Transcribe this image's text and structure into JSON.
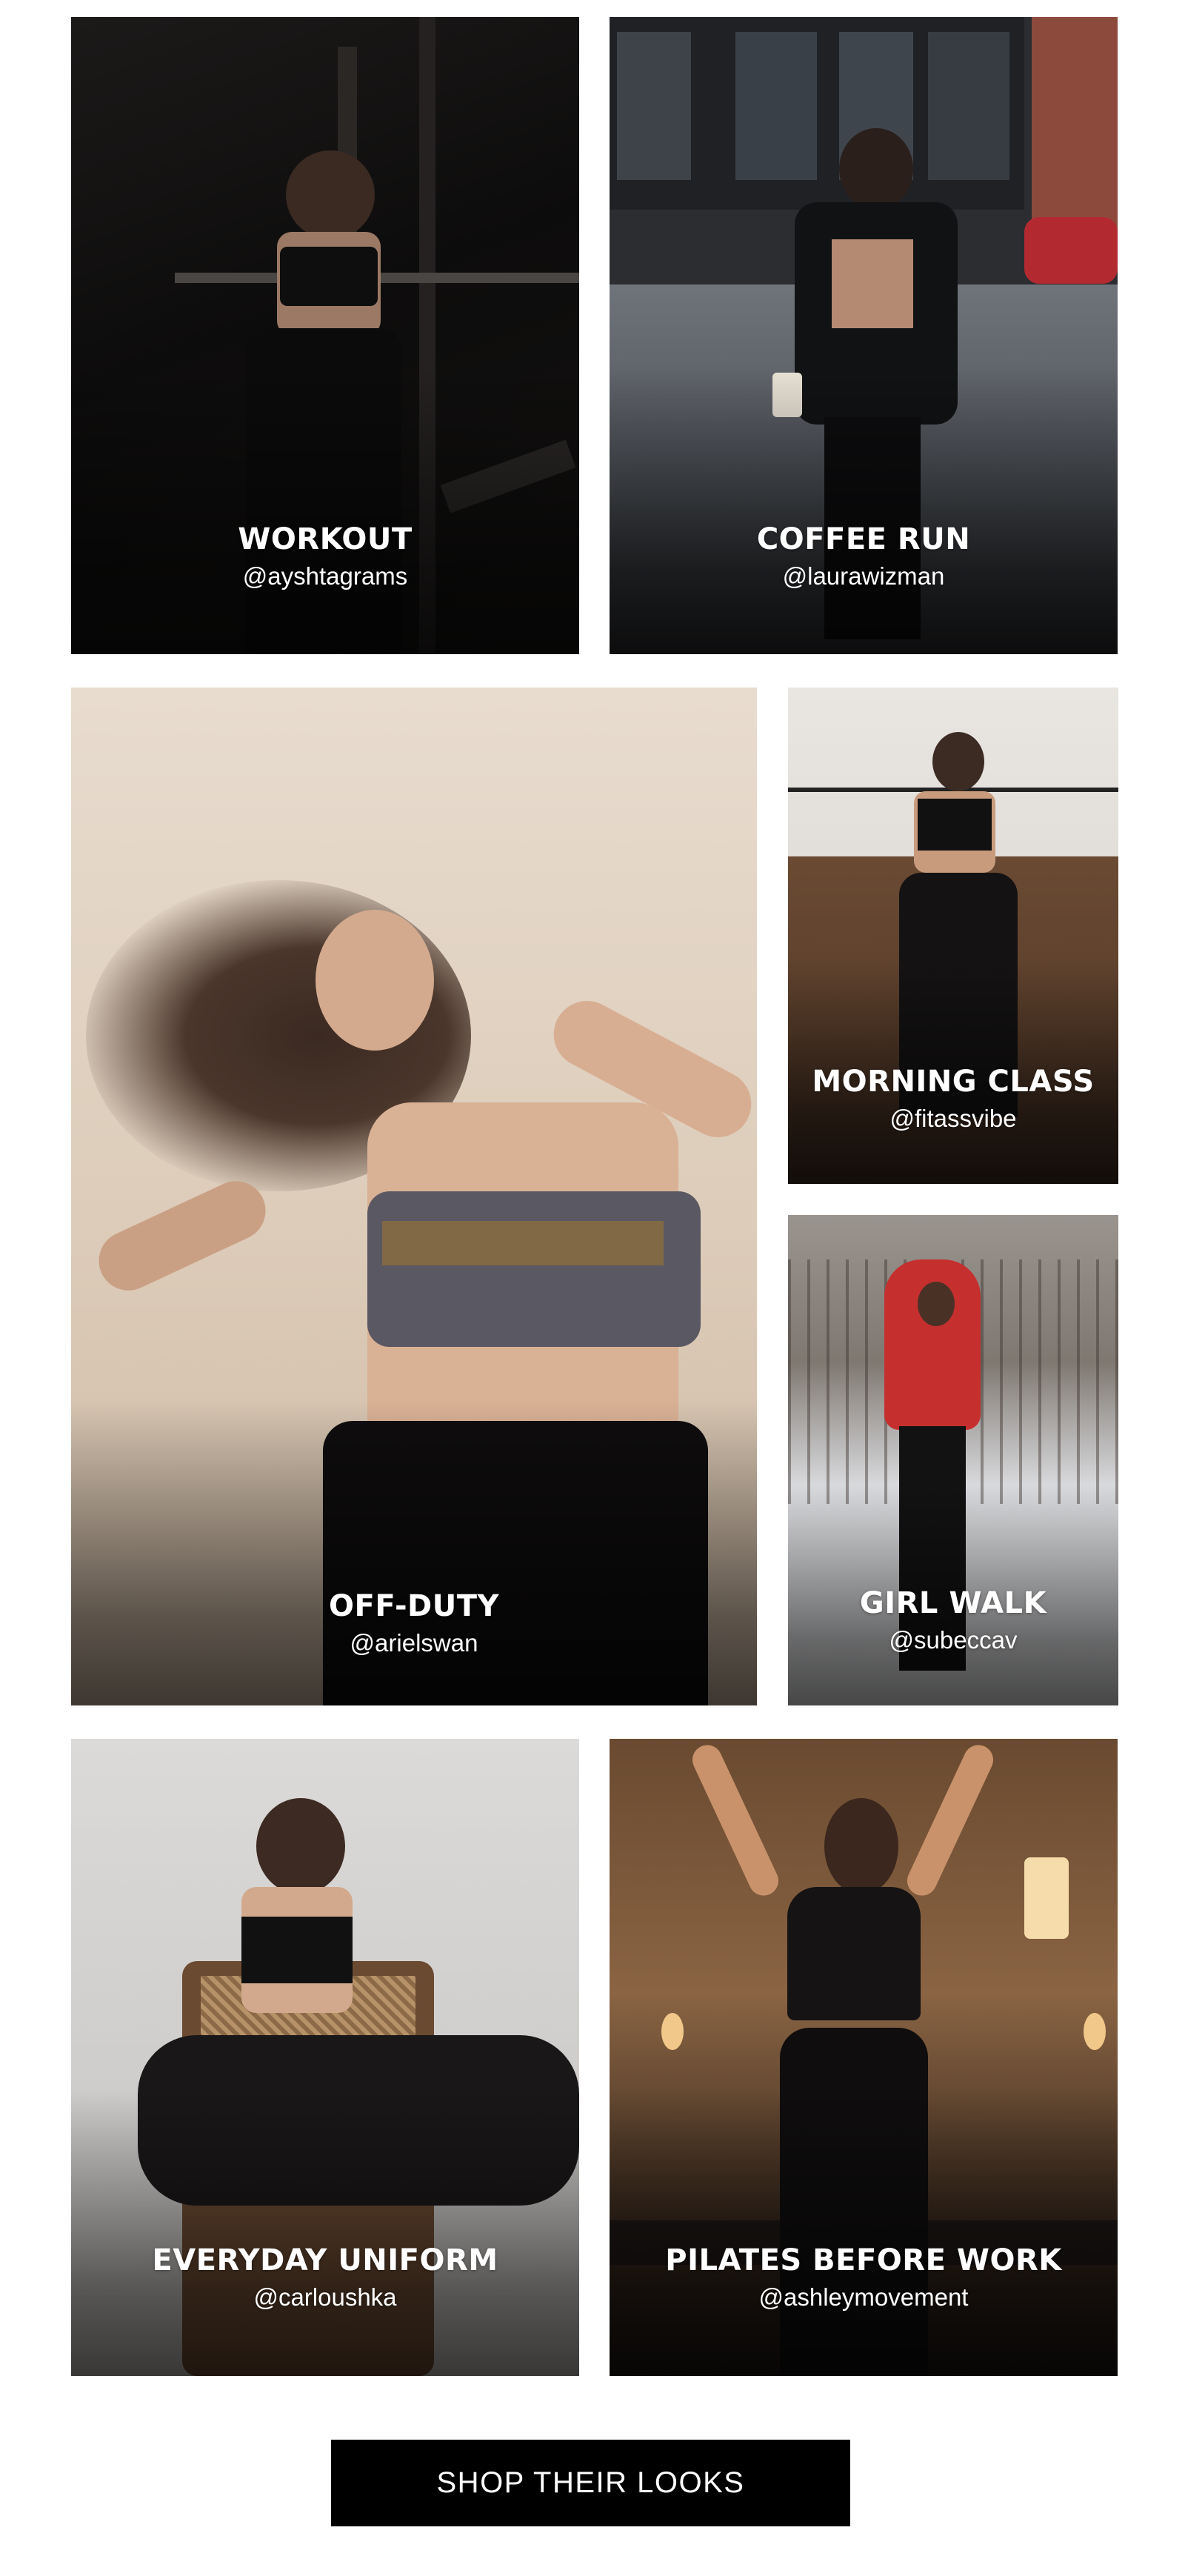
{
  "cards": [
    {
      "title": "WORKOUT",
      "handle": "@ayshtagrams"
    },
    {
      "title": "COFFEE RUN",
      "handle": "@laurawizman"
    },
    {
      "title": "OFF-DUTY",
      "handle": "@arielswan"
    },
    {
      "title": "MORNING CLASS",
      "handle": "@fitassvibe"
    },
    {
      "title": "GIRL WALK",
      "handle": "@subeccav"
    },
    {
      "title": "EVERYDAY UNIFORM",
      "handle": "@carloushka"
    },
    {
      "title": "PILATES BEFORE WORK",
      "handle": "@ashleymovement"
    }
  ],
  "cta": {
    "label": "SHOP THEIR LOOKS"
  },
  "colors": {
    "cta_background": "#000000",
    "cta_text": "#ffffff",
    "caption_text": "#ffffff"
  }
}
